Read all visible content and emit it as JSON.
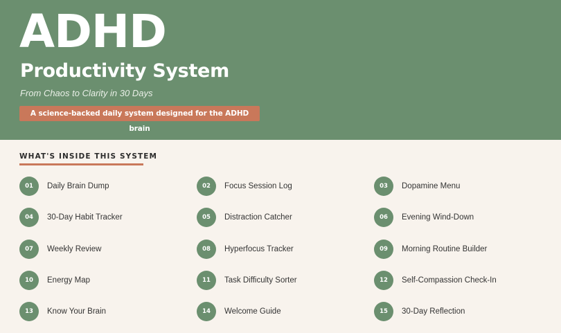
{
  "hero": {
    "title": "ADHD",
    "subtitle": "Productivity System",
    "tagline": "From Chaos to Clarity in 30 Days",
    "badge": "A science-backed daily system designed for the ADHD brain"
  },
  "contents": {
    "heading": "WHAT'S INSIDE THIS SYSTEM",
    "items": [
      {
        "num": "01",
        "label": "Daily Brain Dump"
      },
      {
        "num": "02",
        "label": "Focus Session Log"
      },
      {
        "num": "03",
        "label": "Dopamine Menu"
      },
      {
        "num": "04",
        "label": "30-Day Habit Tracker"
      },
      {
        "num": "05",
        "label": "Distraction Catcher"
      },
      {
        "num": "06",
        "label": "Evening Wind-Down"
      },
      {
        "num": "07",
        "label": "Weekly Review"
      },
      {
        "num": "08",
        "label": "Hyperfocus Tracker"
      },
      {
        "num": "09",
        "label": "Morning Routine Builder"
      },
      {
        "num": "10",
        "label": "Energy Map"
      },
      {
        "num": "11",
        "label": "Task Difficulty Sorter"
      },
      {
        "num": "12",
        "label": "Self-Compassion Check-In"
      },
      {
        "num": "13",
        "label": "Know Your Brain"
      },
      {
        "num": "14",
        "label": "Welcome Guide"
      },
      {
        "num": "15",
        "label": "30-Day Reflection"
      }
    ]
  },
  "colors": {
    "hero_bg": "#6b8f6f",
    "accent": "#c9785a",
    "page_bg": "#f8f3ed",
    "number_badge": "#6b8f6f"
  }
}
